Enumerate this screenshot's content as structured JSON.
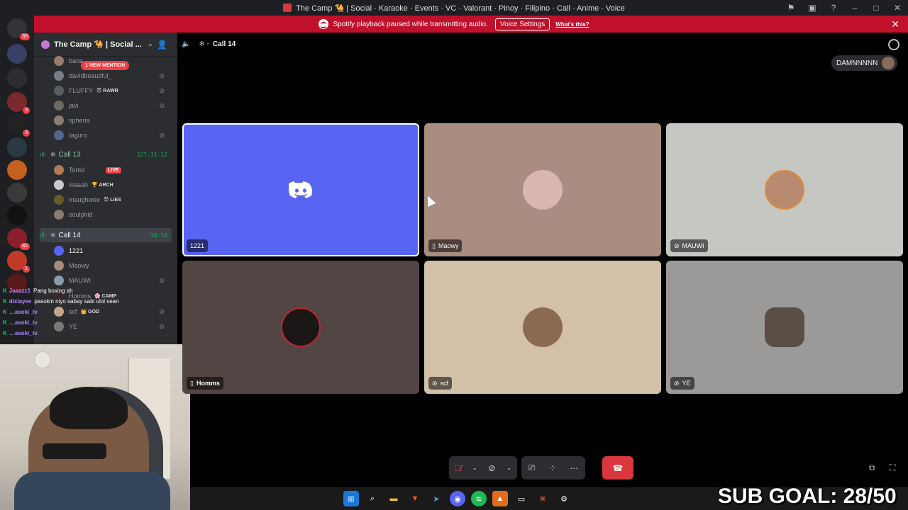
{
  "window": {
    "title": "The Camp 🐪 | Social · Karaoke · Events · VC · Valorant · Pinoy · Filipino · Call · Anime · Voice"
  },
  "banner": {
    "message": "Spotify playback paused while transmitting audio.",
    "button": "Voice Settings",
    "link": "What's this?"
  },
  "rail": {
    "dm_badge": "33",
    "badges": [
      "3",
      "3",
      "82",
      "1"
    ]
  },
  "server": {
    "name": "The Camp 🐪 | Social ...",
    "new_mention": "1 NEW MENTION"
  },
  "voice_users_top": [
    {
      "name": "bana",
      "tag": "",
      "color": "#9c7b6a"
    },
    {
      "name": "davidbeautiful_",
      "tag": "",
      "color": "#7a7f86"
    },
    {
      "name": "FLUFFY",
      "tag": "😈 RAWR",
      "color": "#5a5d63"
    },
    {
      "name": "javi",
      "tag": "",
      "color": "#6f6a63"
    },
    {
      "name": "spheria",
      "tag": "",
      "color": "#8a7d74"
    },
    {
      "name": "taguro",
      "tag": "",
      "color": "#4f6a8a"
    }
  ],
  "channel_call13": {
    "name": "Call 13",
    "timer": "327:31:12"
  },
  "call13_users": [
    {
      "name": "Tortol",
      "tag": "",
      "live": "LIVE",
      "color": "#b07a54"
    },
    {
      "name": "inaaah",
      "tag": "🏆 ARCH",
      "color": "#c9c9c9"
    },
    {
      "name": "maughwee",
      "tag": "😈 LIES",
      "color": "#6a5a2a"
    },
    {
      "name": "soulphid",
      "tag": "",
      "color": "#8a7c70"
    }
  ],
  "channel_call14": {
    "name": "Call 14",
    "timer": "38:34"
  },
  "call14_users": [
    {
      "name": "1221",
      "tag": "",
      "color": "#5865f2"
    },
    {
      "name": "Maowy",
      "tag": "",
      "color": "#a98a7c"
    },
    {
      "name": "MAUWI",
      "tag": "",
      "color": "#8a9aa8"
    },
    {
      "name": "Homms",
      "tag": "🌸 CAMP",
      "color": "#3a2a2a"
    },
    {
      "name": "scf",
      "tag": "👑 GOD",
      "color": "#caa488"
    },
    {
      "name": "YE",
      "tag": "",
      "color": "#7c7a78"
    }
  ],
  "chat_overlay": [
    {
      "user": "Jaaazz1",
      "text": "Pang boxing ah"
    },
    {
      "user": "dixlayee",
      "text": "pasokin niyo sabay sabi ulol sean"
    },
    {
      "user": "…asoki_tv",
      "text": ""
    },
    {
      "user": "…asoki_tv",
      "text": ""
    },
    {
      "user": "…asoki_tv",
      "text": ""
    }
  ],
  "call": {
    "channel": "Call 14",
    "speaker_chip": "DAMNNNNN",
    "tiles": [
      {
        "name": "1221",
        "icon": "",
        "bg": "#5865f2",
        "avatar": ""
      },
      {
        "name": "Maowy",
        "icon": "📱",
        "bg": "#a88d80",
        "avatar": "#d7b7b0"
      },
      {
        "name": "MAUWI",
        "icon": "🎙̸",
        "bg": "#c5c8c2",
        "avatar": "#b88a70"
      },
      {
        "name": "Homms",
        "icon": "📱",
        "bg": "#524543",
        "avatar": "#1b1717"
      },
      {
        "name": "scf",
        "icon": "🎙̸",
        "bg": "#d3c0a8",
        "avatar": "#8a6a50"
      },
      {
        "name": "YE",
        "icon": "🎙̸",
        "bg": "#9c9a98",
        "avatar": "#5a4f46"
      }
    ]
  },
  "controls": {
    "mic": "mic-muted",
    "camera": "camera-off",
    "screen_share": "screen-share",
    "activities": "activities",
    "more": "⋯",
    "disconnect": "disconnect"
  },
  "overlay": {
    "sub_goal": "SUB GOAL: 28/50"
  }
}
